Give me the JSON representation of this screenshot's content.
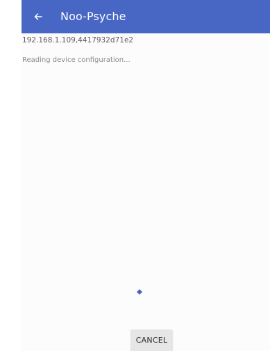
{
  "app_bar": {
    "title": "Noo-Psyche",
    "back_icon": "arrow-left-icon",
    "background_color": "#4866c4"
  },
  "content": {
    "device_id": "192.168.1.109,4417932d71e2",
    "status": "Reading device configuration..."
  },
  "progress": {
    "indicator": "spinner",
    "color": "#4866c4"
  },
  "actions": {
    "cancel_label": "CANCEL"
  }
}
